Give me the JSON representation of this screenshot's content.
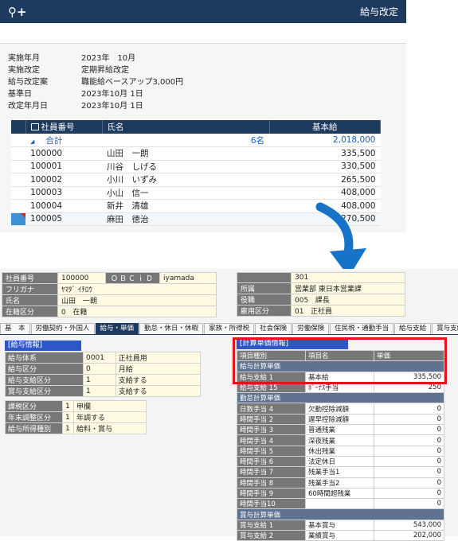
{
  "top": {
    "app_icon": "search-plus-icon",
    "title": "給与改定",
    "info": [
      {
        "label": "実施年月",
        "value": "2023年　10月"
      },
      {
        "label": "実施改定",
        "value": "定期昇給改定"
      },
      {
        "label": "給与改定案",
        "value": "職能給ベースアップ3,000円"
      },
      {
        "label": "基準日",
        "value": "2023年10月 1日"
      },
      {
        "label": "改定年月日",
        "value": "2023年10月 1日"
      }
    ],
    "grid": {
      "headers": {
        "id": "社員番号",
        "name": "氏名",
        "amount": "基本給"
      },
      "total": {
        "label": "合計",
        "count": "6名",
        "amount": "2,018,000"
      },
      "rows": [
        {
          "id": "100000",
          "name": "山田　一朗",
          "amount": "335,500"
        },
        {
          "id": "100001",
          "name": "川谷　しげる",
          "amount": "330,500"
        },
        {
          "id": "100002",
          "name": "小川　いずみ",
          "amount": "265,500"
        },
        {
          "id": "100003",
          "name": "小山　信一",
          "amount": "408,000"
        },
        {
          "id": "100004",
          "name": "新井　清雄",
          "amount": "408,000"
        },
        {
          "id": "100005",
          "name": "麻田　徳治",
          "amount": "270,500"
        }
      ]
    }
  },
  "bottom": {
    "header_left": [
      {
        "label": "社員番号",
        "value": "100000",
        "extra_label": "ＯＢＣｉＤ",
        "extra_value": "iyamada"
      },
      {
        "label": "フリガナ",
        "value": "ﾔﾏﾀﾞ ｲﾁﾛｳ"
      },
      {
        "label": "氏名",
        "value": "山田　一朗"
      },
      {
        "label": "在籍区分",
        "code": "0",
        "value": "在籍"
      }
    ],
    "header_right": [
      {
        "label": "",
        "code": "301",
        "value": ""
      },
      {
        "label": "所属",
        "code": "営業部 東日本営業課",
        "value": ""
      },
      {
        "label": "役職",
        "code": "005",
        "value": "課長"
      },
      {
        "label": "雇用区分",
        "code": "01",
        "value": "正社員"
      }
    ],
    "tabs": [
      "基　本",
      "労働契約・外国人",
      "給与・単価",
      "勤怠・休日・休暇",
      "家族・所得税",
      "社会保険",
      "労働保険",
      "住民税・通勤手当",
      "給与支給",
      "賞与支給"
    ],
    "active_tab": 2,
    "salary_info": {
      "title": "[給与情報]",
      "rows": [
        {
          "label": "給与体系",
          "code": "0001",
          "value": "正社員用"
        },
        {
          "label": "給与区分",
          "code": "0",
          "value": "月給"
        },
        {
          "label": "給与支給区分",
          "code": "1",
          "value": "支給する"
        },
        {
          "label": "賞与支給区分",
          "code": "1",
          "value": "支給する"
        }
      ],
      "rows2": [
        {
          "label": "課税区分",
          "code": "1",
          "value": "甲欄"
        },
        {
          "label": "年末調整区分",
          "code": "1",
          "value": "年調する"
        },
        {
          "label": "給与所得種別",
          "code": "1",
          "value": "給料・賞与"
        }
      ]
    },
    "calc": {
      "title": "[計算単価情報]",
      "col_headers": [
        "項目種別",
        "項目名",
        "単価"
      ],
      "groups": [
        {
          "name": "給与計算単価",
          "rows": [
            {
              "label": "給与支給 1",
              "name": "基本給",
              "amount": "335,500"
            },
            {
              "label": "給与支給 15",
              "name": "ﾎﾞｰﾅｽ手当",
              "amount": "250"
            }
          ]
        },
        {
          "name": "勤怠計算単価",
          "rows": [
            {
              "label": "日数手当 4",
              "name": "欠勤控除減額",
              "amount": "0"
            },
            {
              "label": "時間手当 2",
              "name": "遅早控除減額",
              "amount": "0"
            },
            {
              "label": "時間手当 3",
              "name": "普通残業",
              "amount": "0"
            },
            {
              "label": "時間手当 4",
              "name": "深夜残業",
              "amount": "0"
            },
            {
              "label": "時間手当 5",
              "name": "休出残業",
              "amount": "0"
            },
            {
              "label": "時間手当 6",
              "name": "法定休日",
              "amount": "0"
            },
            {
              "label": "時間手当 7",
              "name": "残業手当1",
              "amount": "0"
            },
            {
              "label": "時間手当 8",
              "name": "残業手当2",
              "amount": "0"
            },
            {
              "label": "時間手当 9",
              "name": "60時間超残業",
              "amount": "0"
            },
            {
              "label": "時間手当10",
              "name": "",
              "amount": "0"
            }
          ]
        },
        {
          "name": "賞与計算単価",
          "rows": [
            {
              "label": "賞与支給 1",
              "name": "基本賞与",
              "amount": "543,000"
            },
            {
              "label": "賞与支給 2",
              "name": "業績賞与",
              "amount": "202,000"
            }
          ]
        }
      ]
    }
  },
  "colors": {
    "navy": "#1e3a5f",
    "accent_blue": "#1a5fbf",
    "highlight_red": "#e3141a",
    "arrow_blue": "#1673c8"
  }
}
